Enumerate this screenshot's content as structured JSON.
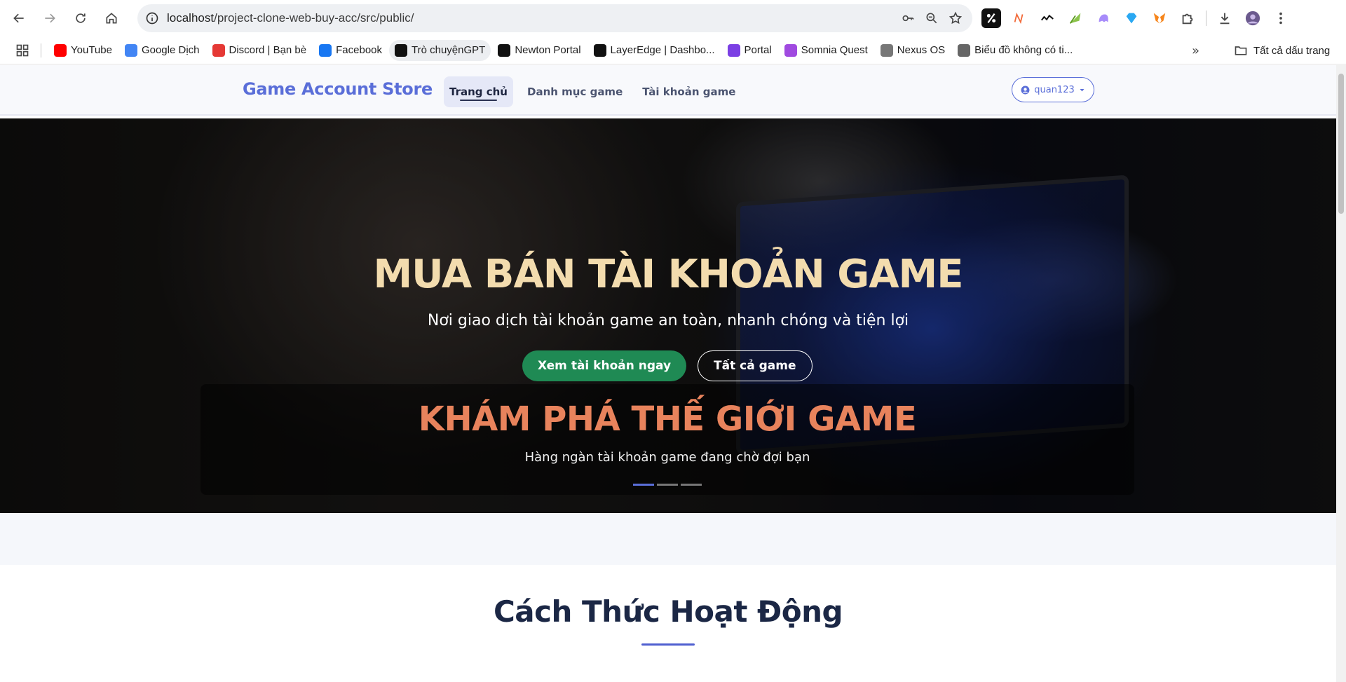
{
  "browser": {
    "url_host": "localhost",
    "url_path": "/project-clone-web-buy-acc/src/public/",
    "bookmarks": [
      {
        "label": "YouTube",
        "icon": "youtube-icon",
        "color": "#ff0000"
      },
      {
        "label": "Google Dịch",
        "icon": "google-translate-icon",
        "color": "#4285f4"
      },
      {
        "label": "Discord | Bạn bè",
        "icon": "discord-icon",
        "color": "#e53935"
      },
      {
        "label": "Facebook",
        "icon": "facebook-icon",
        "color": "#1877f2"
      },
      {
        "label": "Trò chuyệnGPT",
        "icon": "chatgpt-icon",
        "color": "#111111"
      },
      {
        "label": "Newton Portal",
        "icon": "newton-icon",
        "color": "#111111"
      },
      {
        "label": "LayerEdge | Dashbo...",
        "icon": "layeredge-icon",
        "color": "#111111"
      },
      {
        "label": "Portal",
        "icon": "portal-icon",
        "color": "#7b3fe4"
      },
      {
        "label": "Somnia Quest",
        "icon": "somnia-icon",
        "color": "#a04ae0"
      },
      {
        "label": "Nexus OS",
        "icon": "nexus-icon",
        "color": "#777777"
      },
      {
        "label": "Biểu đồ không có ti...",
        "icon": "chart-bookmark-icon",
        "color": "#666666"
      }
    ],
    "all_bookmarks_label": "Tất cả dấu trang",
    "more_bookmarks_label": "»"
  },
  "site": {
    "brand": "Game Account Store",
    "nav": [
      {
        "label": "Trang chủ",
        "active": true
      },
      {
        "label": "Danh mục game",
        "active": false
      },
      {
        "label": "Tài khoản game",
        "active": false
      }
    ],
    "user": "quan123"
  },
  "hero": {
    "title": "MUA BÁN TÀI KHOẢN GAME",
    "subtitle": "Nơi giao dịch tài khoản game an toàn, nhanh chóng và tiện lợi",
    "primary_button": "Xem tài khoản ngay",
    "secondary_button": "Tất cả game",
    "caption_title": "KHÁM PHÁ THẾ GIỚI GAME",
    "caption_subtitle": "Hàng ngàn tài khoản game đang chờ đợi bạn",
    "slides_total": 3,
    "slide_active": 1
  },
  "section": {
    "title": "Cách Thức Hoạt Động"
  },
  "colors": {
    "brand": "#5a6ed8",
    "primary_button": "#1f8a54",
    "hero_title": "#f3dcae",
    "caption_title": "#e8835c",
    "section_title": "#1b2745"
  }
}
